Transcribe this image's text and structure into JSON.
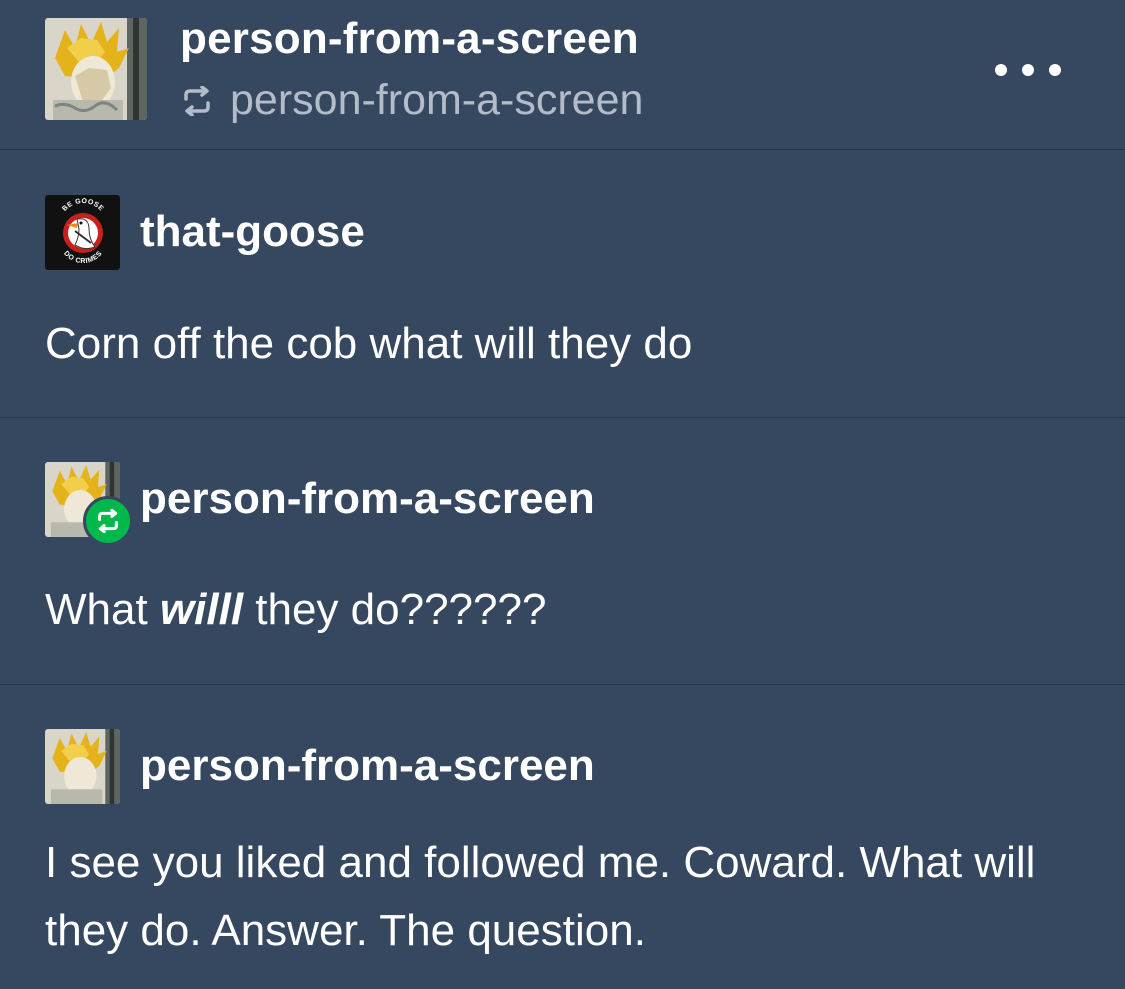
{
  "header": {
    "blog_name": "person-from-a-screen",
    "reblogged_from": "person-from-a-screen"
  },
  "thread": [
    {
      "username": "that-goose",
      "avatar_text_top": "BE GOOSE",
      "avatar_text_bottom": "DO CRIMES",
      "text": "Corn off the cob what will they do"
    },
    {
      "username": "person-from-a-screen",
      "text_before": "What ",
      "text_emphasis": "willl",
      "text_after": " they do??????"
    },
    {
      "username": "person-from-a-screen",
      "text": "I see you liked and followed me. Coward. What will they do. Answer. The question."
    }
  ],
  "colors": {
    "background": "#364760",
    "divider": "#28374d",
    "secondary_text": "#b3bcc9",
    "reblog_badge": "#00b94a"
  }
}
